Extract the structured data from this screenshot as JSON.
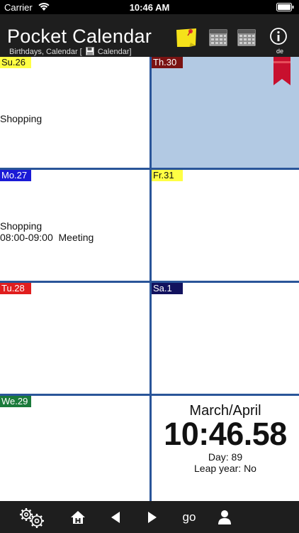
{
  "status_bar": {
    "carrier": "Carrier",
    "time": "10:46 AM",
    "wifi_icon": "wifi-icon",
    "battery_icon": "battery-icon"
  },
  "header": {
    "title": "Pocket Calendar",
    "subtitle_prefix": "Birthdays, Calendar [",
    "subtitle_suffix": "Calendar]",
    "language": "de",
    "icons": [
      "sticky-note-icon",
      "calendar-grid-icon",
      "calendar-grid-icon",
      "info-icon"
    ]
  },
  "days": [
    {
      "label": "Su.26",
      "label_bg": "#ffff44",
      "label_color": "#111111",
      "events": [
        "Shopping"
      ]
    },
    {
      "label": "Th.30",
      "label_bg": "#7a1212",
      "label_color": "#ffffff",
      "events": [],
      "today": true
    },
    {
      "label": "Mo.27",
      "label_bg": "#1a1ad6",
      "label_color": "#ffffff",
      "events": [
        "Shopping",
        "08:00-09:00  Meeting"
      ]
    },
    {
      "label": "Fr.31",
      "label_bg": "#ffff44",
      "label_color": "#111111",
      "events": []
    },
    {
      "label": "Tu.28",
      "label_bg": "#e01e1e",
      "label_color": "#ffffff",
      "events": []
    },
    {
      "label": "Sa.1",
      "label_bg": "#12125e",
      "label_color": "#ffffff",
      "events": []
    },
    {
      "label": "We.29",
      "label_bg": "#1a7a3a",
      "label_color": "#ffffff",
      "events": []
    }
  ],
  "clock": {
    "month": "March/April",
    "time": "10:46.58",
    "day_of_year": "Day: 89",
    "leap_year": "Leap year: No"
  },
  "toolbar": {
    "settings_icon": "gears-icon",
    "home_icon": "home-icon",
    "prev_icon": "left-arrow-icon",
    "next_icon": "right-arrow-icon",
    "go_label": "go",
    "user_icon": "user-icon"
  },
  "colors": {
    "grid_lines": "#2a5599",
    "today_bg": "#b2c9e3",
    "bar_bg": "#1e1e1e",
    "bookmark": "#c8102e"
  }
}
